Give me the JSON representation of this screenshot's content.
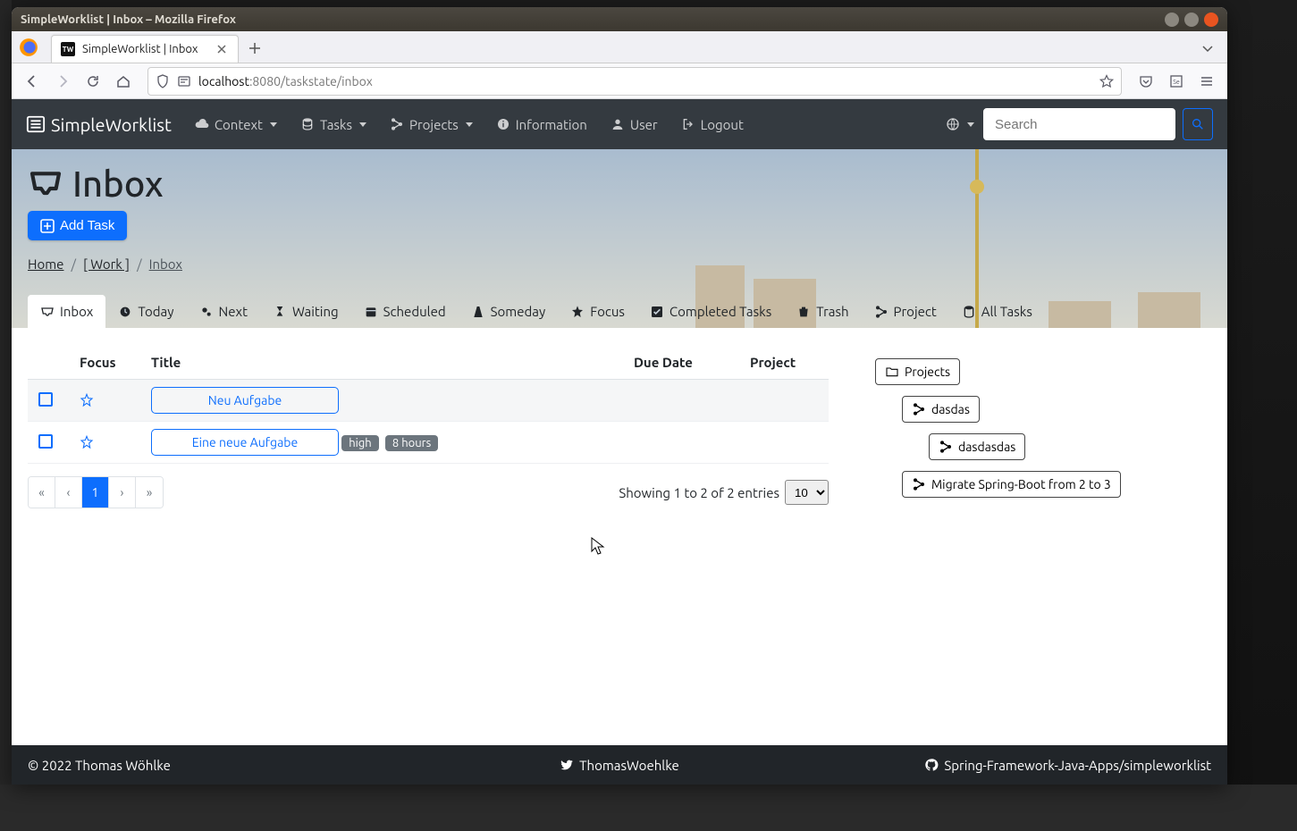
{
  "window": {
    "title": "SimpleWorklist | Inbox – Mozilla Firefox"
  },
  "browser": {
    "tab_title": "SimpleWorklist | Inbox",
    "url_host": "localhost",
    "url_rest": ":8080/taskstate/inbox"
  },
  "navbar": {
    "brand": "SimpleWorklist",
    "items": {
      "context": "Context",
      "tasks": "Tasks",
      "projects": "Projects",
      "information": "Information",
      "user": "User",
      "logout": "Logout"
    },
    "search_placeholder": "Search"
  },
  "hero": {
    "title": "Inbox",
    "add_task": "Add Task",
    "breadcrumb": {
      "home": "Home",
      "work": "[ Work ]",
      "current": "Inbox"
    }
  },
  "tabs": {
    "inbox": "Inbox",
    "today": "Today",
    "next": "Next",
    "waiting": "Waiting",
    "scheduled": "Scheduled",
    "someday": "Someday",
    "focus": "Focus",
    "completed": "Completed Tasks",
    "trash": "Trash",
    "project": "Project",
    "all": "All Tasks"
  },
  "table": {
    "headers": {
      "focus": "Focus",
      "title": "Title",
      "due": "Due Date",
      "project": "Project"
    },
    "rows": [
      {
        "title": "Neu Aufgabe",
        "badges": []
      },
      {
        "title": "Eine neue Aufgabe",
        "badges": [
          "high",
          "8 hours"
        ]
      }
    ]
  },
  "pagination": {
    "first": "«",
    "prev": "‹",
    "page": "1",
    "next": "›",
    "last": "»",
    "showing": "Showing 1 to 2 of 2 entries",
    "pagesize": "10"
  },
  "projects_panel": {
    "root": "Projects",
    "items": [
      {
        "label": "dasdas",
        "indent": 1
      },
      {
        "label": "dasdasdas",
        "indent": 2
      },
      {
        "label": "Migrate Spring-Boot from 2 to 3",
        "indent": 1
      }
    ]
  },
  "footer": {
    "left": "© 2022 Thomas Wöhlke",
    "center": "ThomasWoehlke",
    "right": "Spring-Framework-Java-Apps/simpleworklist"
  }
}
